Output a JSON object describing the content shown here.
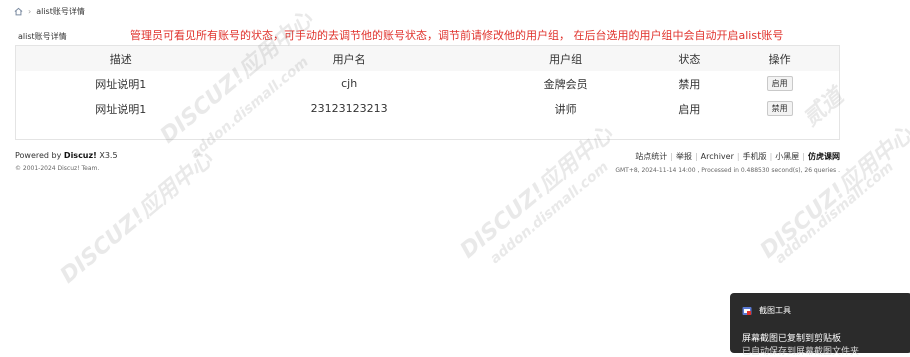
{
  "breadcrumb": {
    "current": "alist账号详情"
  },
  "notice": "管理员可看见所有账号的状态，可手动的去调节他的账号状态，调节前请修改他的用户组， 在后台选用的用户组中会自动开启alist账号",
  "section_title": "alist账号详情",
  "table": {
    "headers": [
      "描述",
      "用户名",
      "用户组",
      "状态",
      "操作"
    ],
    "rows": [
      {
        "desc": "网址说明1",
        "username": "cjh",
        "group": "金牌会员",
        "status": "禁用",
        "action": "启用"
      },
      {
        "desc": "网址说明1",
        "username": "23123123213",
        "group": "讲师",
        "status": "启用",
        "action": "禁用"
      }
    ]
  },
  "footer": {
    "powered_prefix": "Powered by ",
    "powered_brand": "Discuz!",
    "powered_version": " X3.5",
    "copyright": "© 2001-2024 Discuz! Team.",
    "links": [
      "站点统计",
      "举报",
      "Archiver",
      "手机版",
      "小黑屋",
      "仿虎课网"
    ],
    "stats": "GMT+8, 2024-11-14 14:00 , Processed in 0.488530 second(s), 26 queries ."
  },
  "watermark": {
    "text": "DISCUZ!应用中心",
    "domain": "addon.dismall.com",
    "brand": "贰道"
  },
  "toast": {
    "app": "截图工具",
    "title": "屏幕截图已复制到剪贴板",
    "subtitle": "已自动保存到屏幕截图文件夹"
  }
}
